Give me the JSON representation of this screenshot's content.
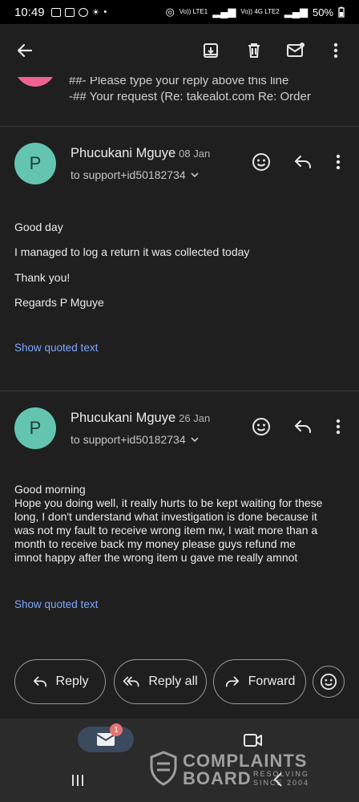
{
  "status_bar": {
    "time": "10:49",
    "battery": "50%",
    "net1": "Vo)) LTE1",
    "net2": "Vo)) 4G LTE2"
  },
  "toolbar": {
    "back_icon": "arrow-left-icon",
    "archive_icon": "archive-icon",
    "delete_icon": "trash-icon",
    "mark_unread_icon": "mail-icon",
    "more_icon": "more-vert-icon"
  },
  "previous_message": {
    "line1": "##- Please type your reply above this line",
    "line2": "-## Your request (Re: takealot.com Re: Order",
    "avatar_color": "#f06292"
  },
  "messages": [
    {
      "avatar_letter": "P",
      "avatar_color": "#63c5b0",
      "sender": "Phucukani Mguye",
      "date": "08 Jan",
      "recipient": "to support+id50182734",
      "body": [
        "Good day",
        "I managed to log a return it was collected today",
        "Thank you!",
        "Regards P Mguye"
      ],
      "quoted_link": "Show quoted text"
    },
    {
      "avatar_letter": "P",
      "avatar_color": "#63c5b0",
      "sender": "Phucukani Mguye",
      "date": "26 Jan",
      "recipient": "to support+id50182734",
      "body": [
        "Good morning",
        "Hope you doing well, it really hurts to be kept waiting for these",
        "long, I don't understand what investigation is done because it",
        "was not my fault to receive wrong item nw, I wait more than a",
        "month to receive back my money please guys refund me",
        "imnot happy after the wrong item u gave me really amnot"
      ],
      "quoted_link": "Show quoted text"
    }
  ],
  "actions": {
    "reply": "Reply",
    "reply_all": "Reply all",
    "forward": "Forward",
    "emoji_icon": "emoji-add-icon"
  },
  "bottom_nav": {
    "mail_badge": "1",
    "mail_icon": "mail-icon",
    "meet_icon": "video-icon"
  },
  "watermark": {
    "line1": "COMPLAINTS",
    "line2": "BOARD",
    "line3": "RESOLVING",
    "line4": "SINCE 2004"
  },
  "colors": {
    "background": "#1f1f1f",
    "link": "#7ea8ff",
    "avatar": "#63c5b0"
  }
}
